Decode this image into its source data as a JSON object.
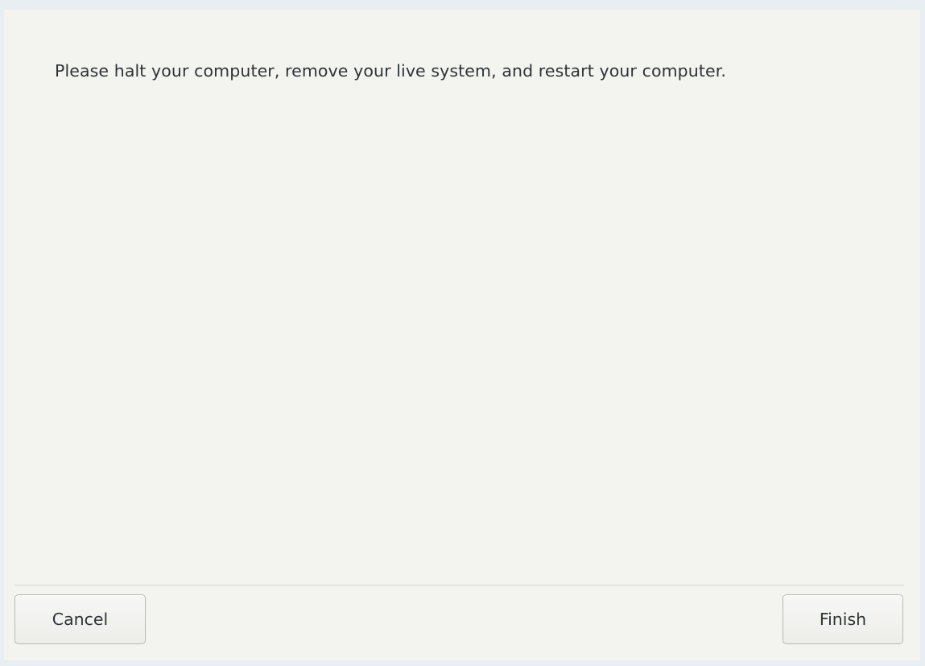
{
  "dialog": {
    "message": "Please halt your computer, remove your live system, and restart your computer.",
    "cancel_label": "Cancel",
    "finish_label": "Finish"
  },
  "colors": {
    "window_background": "#f3f3ef",
    "outer_background": "#e9eef3",
    "text": "#2e3436",
    "button_border": "#b9b9b3"
  }
}
